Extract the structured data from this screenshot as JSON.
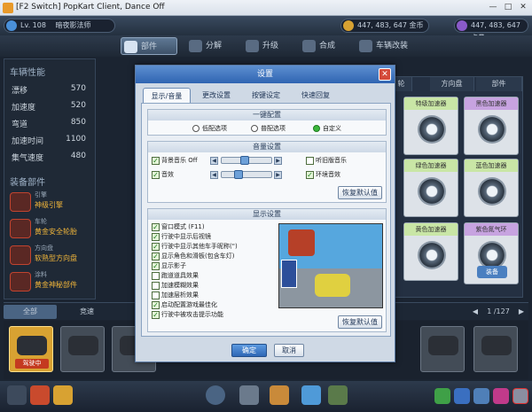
{
  "window": {
    "title": "[F2 Switch] PopKart Client, Dance Off",
    "min": "—",
    "max": "□",
    "close": "✕"
  },
  "topbar": {
    "level": "Lv. 108",
    "name": "暗夜影法师",
    "gold": "447, 483, 647 金币",
    "coupon": "447, 483, 647 点券"
  },
  "tabs": [
    {
      "label": "部件"
    },
    {
      "label": "分解"
    },
    {
      "label": "升级"
    },
    {
      "label": "合成"
    },
    {
      "label": "车辆改装"
    }
  ],
  "left": {
    "perf_title": "车辆性能",
    "stats": [
      {
        "label": "漂移",
        "value": "570"
      },
      {
        "label": "加速度",
        "value": "520"
      },
      {
        "label": "弯道",
        "value": "850"
      },
      {
        "label": "加速时间",
        "value": "1100"
      },
      {
        "label": "集气速度",
        "value": "480"
      }
    ],
    "parts_title": "装备部件",
    "parts": [
      {
        "slot": "引擎",
        "name": "神级引擎"
      },
      {
        "slot": "车轮",
        "name": "黄金安全轮胎"
      },
      {
        "slot": "方向盘",
        "name": "软熟型方向盘"
      },
      {
        "slot": "涂料",
        "name": "黄金神秘部件"
      }
    ]
  },
  "right": {
    "tabs": [
      "轮",
      "方向盘",
      "部件"
    ],
    "cards": [
      {
        "title": "特级加速器"
      },
      {
        "title": "黑色加速器"
      },
      {
        "title": "绿色加速器"
      },
      {
        "title": "蓝色加速器"
      },
      {
        "title": "黄色加速器"
      },
      {
        "title": "紫色氮气环"
      }
    ],
    "equip": "装备"
  },
  "bottom": {
    "tabs": [
      "全部",
      "竞速"
    ],
    "page": "1 /127",
    "selected_tag": "驾驶中"
  },
  "dialog": {
    "title": "设置",
    "tabs": [
      "显示/音量",
      "更改设置",
      "按键设定",
      "快速回复"
    ],
    "preset": {
      "title": "一键配置",
      "options": [
        "低配选项",
        "普配选项",
        "自定义"
      ],
      "selected": 2
    },
    "sound": {
      "title": "音量设置",
      "bgm": "背景音乐 Off",
      "sfx": "音效",
      "old_bgm": "听旧版音乐",
      "ambient": "环境音效",
      "reset": "恢复默认值",
      "bgm_level": 0.45,
      "sfx_level": 0.3
    },
    "display": {
      "title": "显示设置",
      "options": [
        {
          "label": "窗口模式 (F11)",
          "on": true
        },
        {
          "label": "行驶中显示后视镜",
          "on": true
        },
        {
          "label": "行驶中显示其他车手昵称(\")",
          "on": true
        },
        {
          "label": "显示角色和滑板(包含车灯)",
          "on": true
        },
        {
          "label": "显示影子",
          "on": true
        },
        {
          "label": "跑道道具效果",
          "on": false
        },
        {
          "label": "加速模糊效果",
          "on": false
        },
        {
          "label": "加速层析效果",
          "on": false
        },
        {
          "label": "启动配置游戏最佳化",
          "on": true
        },
        {
          "label": "行驶中被攻击提示功能",
          "on": true
        }
      ],
      "reset": "恢复默认值"
    },
    "ok": "确定",
    "cancel": "取消"
  }
}
